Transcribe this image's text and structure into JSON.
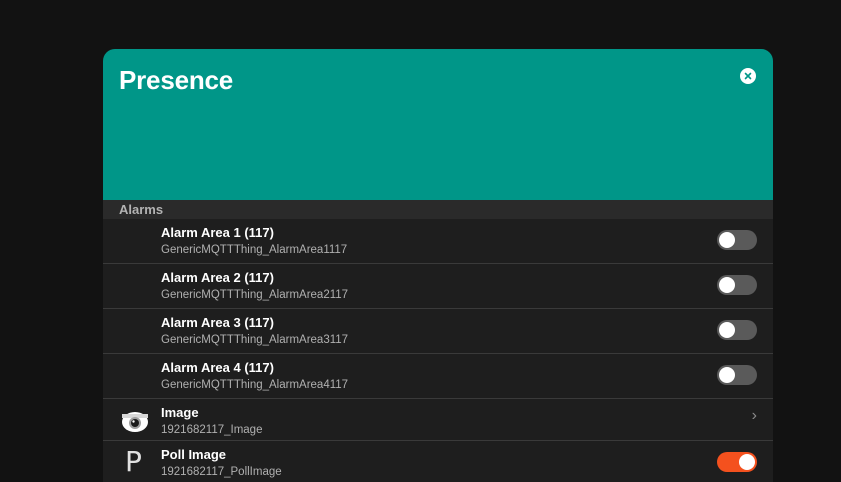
{
  "card": {
    "title": "Presence",
    "close_icon": "close-circle-icon",
    "header_color": "#009688"
  },
  "section": {
    "label": "Alarms"
  },
  "rows": [
    {
      "title": "Alarm Area 1 (117)",
      "subtitle": "GenericMQTTThing_AlarmArea1117",
      "control": "toggle",
      "on": false
    },
    {
      "title": "Alarm Area 2 (117)",
      "subtitle": "GenericMQTTThing_AlarmArea2117",
      "control": "toggle",
      "on": false
    },
    {
      "title": "Alarm Area 3 (117)",
      "subtitle": "GenericMQTTThing_AlarmArea3117",
      "control": "toggle",
      "on": false
    },
    {
      "title": "Alarm Area 4 (117)",
      "subtitle": "GenericMQTTThing_AlarmArea4117",
      "control": "toggle",
      "on": false
    },
    {
      "title": "Image",
      "subtitle": "1921682117_Image",
      "control": "chevron",
      "icon": "camera-icon"
    },
    {
      "title": "Poll Image",
      "subtitle": "1921682117_PollImage",
      "control": "toggle",
      "on": true,
      "icon_letter": "P"
    }
  ],
  "colors": {
    "toggle_on": "#f4511e",
    "toggle_off": "#5a5a5a"
  }
}
